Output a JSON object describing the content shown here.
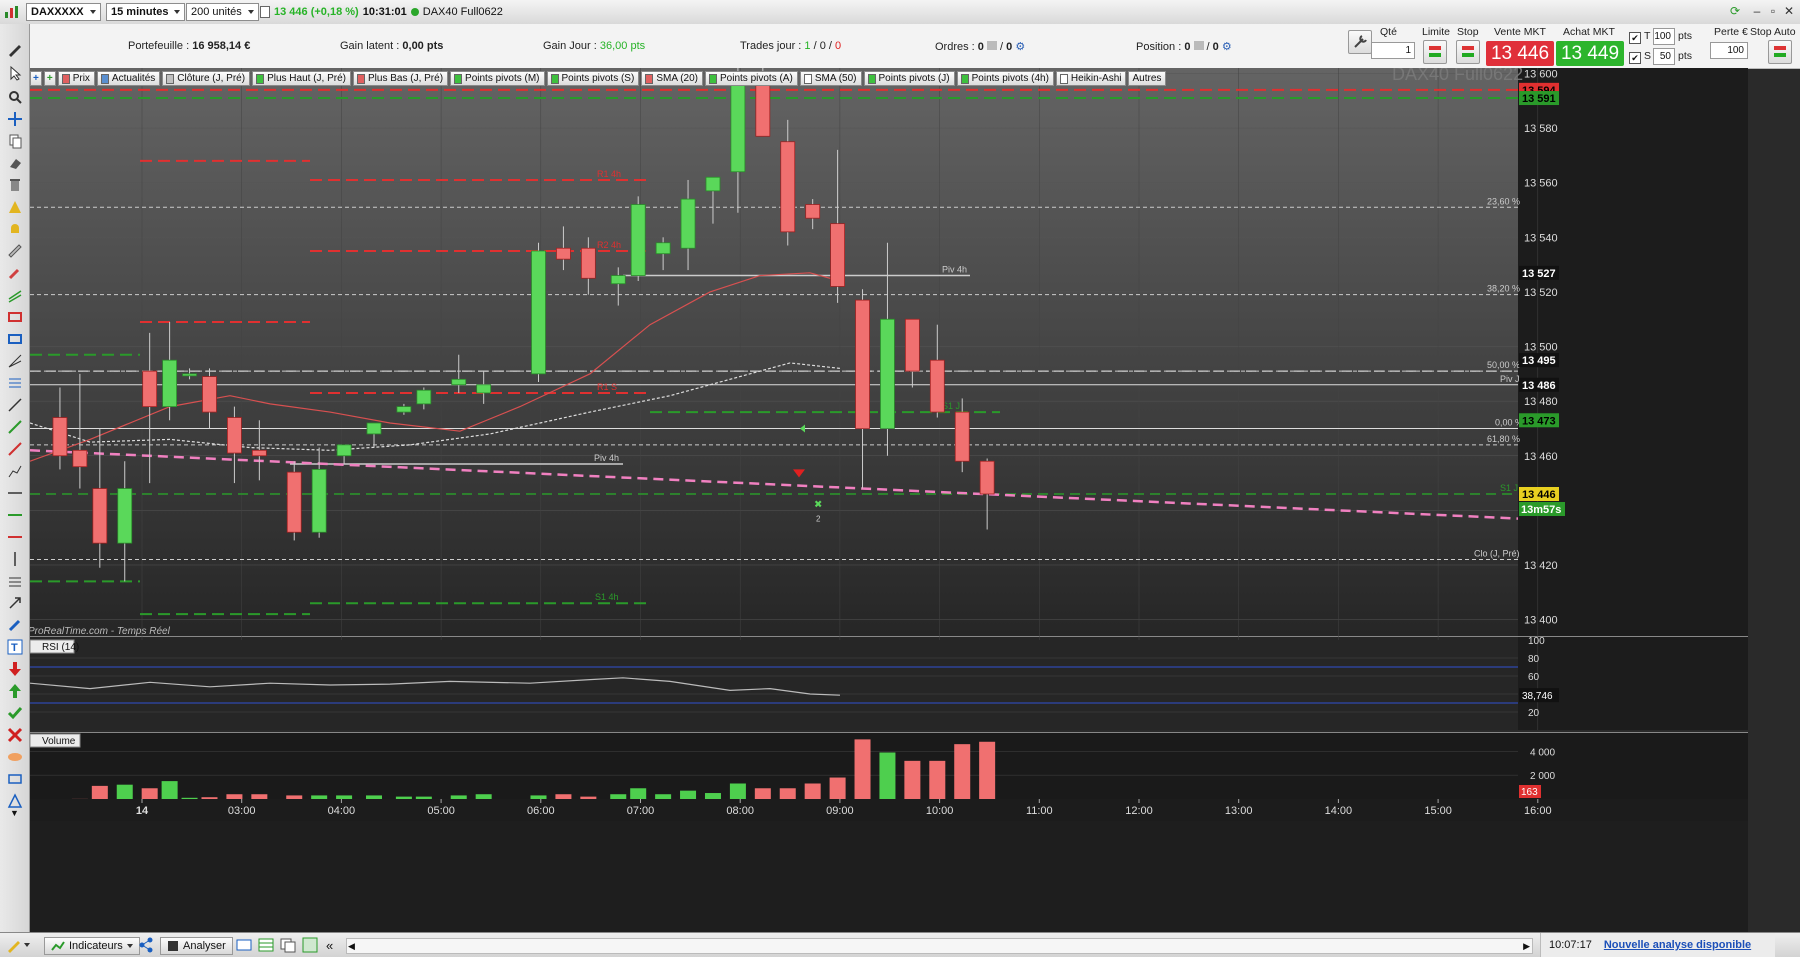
{
  "topbar": {
    "symbol": "DAXXXXX",
    "timeframe": "15 minutes",
    "units": "200 unités",
    "quote": "13 446 (+0,18 %)",
    "time": "10:31:01",
    "instrument": "DAX40 Full0622"
  },
  "infobar": {
    "portefeuille_label": "Portefeuille :",
    "portefeuille_value": "16 958,14 €",
    "gain_latent_label": "Gain latent :",
    "gain_latent_value": "0,00 pts",
    "gain_jour_label": "Gain Jour :",
    "gain_jour_value": "36,00 pts",
    "trades_label": "Trades jour :",
    "trades_a": "1",
    "trades_b": "0",
    "trades_c": "0",
    "ordres_label": "Ordres :",
    "ordres_a": "0",
    "ordres_b": "0",
    "position_label": "Position :",
    "position_a": "0",
    "position_b": "0"
  },
  "trade_panel": {
    "qte_label": "Qté",
    "qte_value": "1",
    "limite_label": "Limite",
    "stop_label": "Stop",
    "vente_label": "Vente MKT",
    "vente_value": "13 446",
    "achat_label": "Achat MKT",
    "achat_value": "13 449",
    "t_label": "T",
    "t_value": "100",
    "t_unit": "pts",
    "s_label": "S",
    "s_value": "50",
    "s_unit": "pts",
    "perte_label": "Perte €",
    "perte_value": "100",
    "auto_label": "Stop Auto",
    "colors": {
      "sell": "#e0303a",
      "buy": "#2cb52c"
    }
  },
  "indicators": [
    {
      "label": "Prix",
      "color": "#e06060"
    },
    {
      "label": "Actualités",
      "color": "#5a8fd0"
    },
    {
      "label": "Clôture (J, Pré)",
      "color": "#c0c0c0"
    },
    {
      "label": "Plus Haut (J, Pré)",
      "color": "#3ec03e"
    },
    {
      "label": "Plus Bas (J, Pré)",
      "color": "#e06060"
    },
    {
      "label": "Points pivots (M)",
      "color": "#3ec03e"
    },
    {
      "label": "Points pivots (S)",
      "color": "#3ec03e"
    },
    {
      "label": "SMA (20)",
      "color": "#e06060"
    },
    {
      "label": "Points pivots (A)",
      "color": "#3ec03e"
    },
    {
      "label": "SMA (50)",
      "color": "#ffffff"
    },
    {
      "label": "Points pivots (J)",
      "color": "#3ec03e"
    },
    {
      "label": "Points pivots (4h)",
      "color": "#3ec03e"
    },
    {
      "label": "Heikin-Ashi",
      "color": "#ffffff"
    },
    {
      "label": "Autres",
      "color": ""
    }
  ],
  "chart_data": {
    "type": "candlestick",
    "title": "DAX40 Full0622",
    "watermark": "ProRealTime.com - Temps Réel",
    "x_ticks": [
      "14",
      "03:00",
      "04:00",
      "05:00",
      "06:00",
      "07:00",
      "08:00",
      "09:00",
      "10:00",
      "11:00",
      "12:00",
      "13:00",
      "14:00",
      "15:00",
      "16:00"
    ],
    "y_ticks": [
      13600,
      13580,
      13560,
      13540,
      13520,
      13500,
      13480,
      13460,
      13440,
      13420,
      13400
    ],
    "y_tick_labels": [
      "13 600",
      "13 580",
      "13 560",
      "13 540",
      "13 520",
      "13 500",
      "13 480",
      "13 460",
      "13 440",
      "13 420",
      "13 400"
    ],
    "ylim": [
      13394,
      13602
    ],
    "candles": [
      {
        "t": 0.2,
        "o": 13474,
        "h": 13485,
        "l": 13455,
        "c": 13460
      },
      {
        "t": 0.4,
        "o": 13462,
        "h": 13490,
        "l": 13448,
        "c": 13456
      },
      {
        "t": 0.6,
        "o": 13448,
        "h": 13470,
        "l": 13419,
        "c": 13428
      },
      {
        "t": 0.85,
        "o": 13428,
        "h": 13458,
        "l": 13414,
        "c": 13448
      },
      {
        "t": 1.1,
        "o": 13491,
        "h": 13505,
        "l": 13450,
        "c": 13478
      },
      {
        "t": 1.3,
        "o": 13478,
        "h": 13509,
        "l": 13473,
        "c": 13495
      },
      {
        "t": 1.5,
        "o": 13490,
        "h": 13492,
        "l": 13488,
        "c": 13490
      },
      {
        "t": 1.7,
        "o": 13489,
        "h": 13492,
        "l": 13470,
        "c": 13476
      },
      {
        "t": 1.95,
        "o": 13474,
        "h": 13478,
        "l": 13450,
        "c": 13461
      },
      {
        "t": 2.2,
        "o": 13462,
        "h": 13473,
        "l": 13451,
        "c": 13460
      },
      {
        "t": 2.55,
        "o": 13454,
        "h": 13458,
        "l": 13429,
        "c": 13432
      },
      {
        "t": 2.8,
        "o": 13432,
        "h": 13463,
        "l": 13430,
        "c": 13455
      },
      {
        "t": 3.05,
        "o": 13460,
        "h": 13463,
        "l": 13457,
        "c": 13464
      },
      {
        "t": 3.35,
        "o": 13468,
        "h": 13470,
        "l": 13463,
        "c": 13472
      },
      {
        "t": 3.65,
        "o": 13476,
        "h": 13479,
        "l": 13475,
        "c": 13478
      },
      {
        "t": 3.85,
        "o": 13479,
        "h": 13485,
        "l": 13477,
        "c": 13484
      },
      {
        "t": 4.2,
        "o": 13486,
        "h": 13497,
        "l": 13483,
        "c": 13488
      },
      {
        "t": 4.45,
        "o": 13483,
        "h": 13491,
        "l": 13479,
        "c": 13486
      },
      {
        "t": 5.0,
        "o": 13490,
        "h": 13538,
        "l": 13487,
        "c": 13535
      },
      {
        "t": 5.25,
        "o": 13536,
        "h": 13544,
        "l": 13528,
        "c": 13532
      },
      {
        "t": 5.5,
        "o": 13536,
        "h": 13540,
        "l": 13519,
        "c": 13525
      },
      {
        "t": 5.8,
        "o": 13523,
        "h": 13529,
        "l": 13515,
        "c": 13526
      },
      {
        "t": 6.0,
        "o": 13526,
        "h": 13555,
        "l": 13524,
        "c": 13552
      },
      {
        "t": 6.25,
        "o": 13534,
        "h": 13540,
        "l": 13528,
        "c": 13538
      },
      {
        "t": 6.5,
        "o": 13536,
        "h": 13561,
        "l": 13528,
        "c": 13554
      },
      {
        "t": 6.75,
        "o": 13557,
        "h": 13562,
        "l": 13545,
        "c": 13562
      },
      {
        "t": 7.0,
        "o": 13564,
        "h": 13608,
        "l": 13549,
        "c": 13600
      },
      {
        "t": 7.25,
        "o": 13600,
        "h": 13608,
        "l": 13577,
        "c": 13577
      },
      {
        "t": 7.5,
        "o": 13575,
        "h": 13583,
        "l": 13537,
        "c": 13542
      },
      {
        "t": 7.75,
        "o": 13552,
        "h": 13554,
        "l": 13543,
        "c": 13547
      },
      {
        "t": 8.0,
        "o": 13545,
        "h": 13572,
        "l": 13516,
        "c": 13522
      },
      {
        "t": 8.25,
        "o": 13517,
        "h": 13521,
        "l": 13448,
        "c": 13470
      },
      {
        "t": 8.5,
        "o": 13470,
        "h": 13538,
        "l": 13460,
        "c": 13510
      },
      {
        "t": 8.75,
        "o": 13510,
        "h": 13510,
        "l": 13485,
        "c": 13491
      },
      {
        "t": 9.0,
        "o": 13495,
        "h": 13508,
        "l": 13474,
        "c": 13476
      },
      {
        "t": 9.25,
        "o": 13476,
        "h": 13481,
        "l": 13454,
        "c": 13458
      },
      {
        "t": 9.5,
        "o": 13458,
        "h": 13459,
        "l": 13433,
        "c": 13446
      }
    ],
    "volume_ticks": [
      "4 000",
      "2 000"
    ],
    "volume_last": "163",
    "volume": [
      0,
      9,
      1100,
      1200,
      900,
      1500,
      100,
      150,
      400,
      400,
      300,
      300,
      300,
      300,
      200,
      200,
      300,
      400,
      300,
      400,
      200,
      400,
      900,
      400,
      700,
      500,
      1300,
      900,
      900,
      1300,
      1800,
      5000,
      3900,
      3200,
      3200,
      4600,
      4800
    ],
    "rsi_ticks": [
      "100",
      "80",
      "60",
      "40",
      "20"
    ],
    "rsi_value": "38,746",
    "rsi_label": "RSI (14)",
    "volume_label": "Volume"
  },
  "price_labels": {
    "p1": "13 594",
    "p2": "13 591",
    "p3": "13 527",
    "p4": "13 495",
    "p5": "13 486",
    "p6": "13 473",
    "p7": "13 446",
    "countdown": "13m57s"
  },
  "fib": {
    "f1": "23,60 %",
    "f2": "38,20 %",
    "f3": "50,00 %",
    "f4": "0,00 %",
    "f5": "61,80 %",
    "piv_j": "Piv J",
    "piv4h_a": "Piv 4h",
    "piv4h_b": "Piv 4h",
    "clo": "Clo (J, Pré)",
    "s14h": "S1 4h",
    "s1": "S1 J",
    "r14h": "R1 4h",
    "r2": "R2 4h",
    "r1s": "R1 S",
    "s1j": "S1 J",
    "marker": "2"
  },
  "bottombar": {
    "indicateurs": "Indicateurs",
    "analyser": "Analyser",
    "status_time": "10:07:17",
    "status_link": "Nouvelle analyse disponible"
  }
}
